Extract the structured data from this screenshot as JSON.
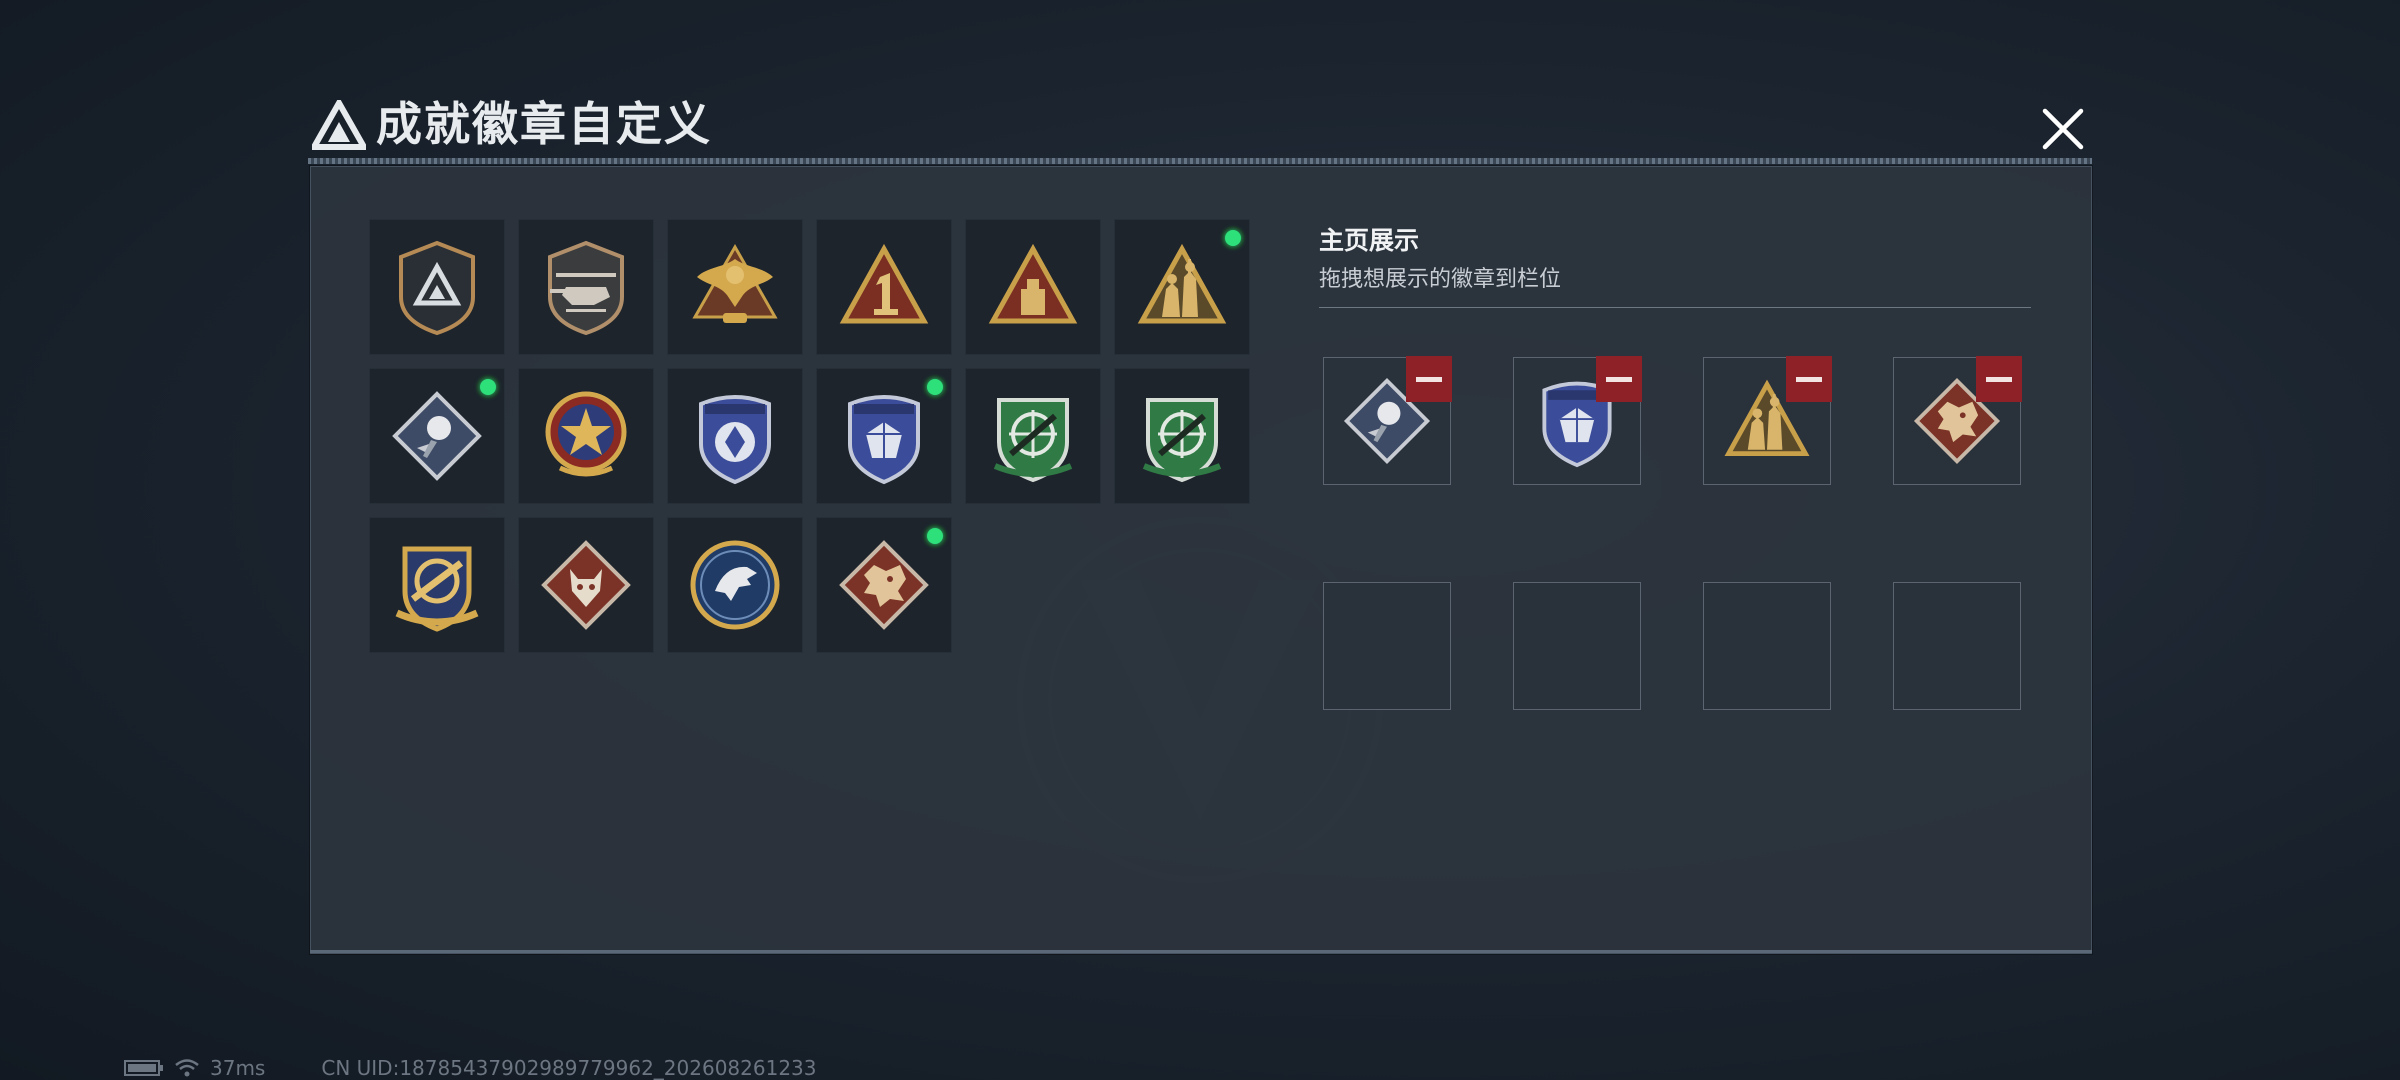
{
  "dialog": {
    "title": "成就徽章自定义",
    "close_label": "close"
  },
  "badges": [
    {
      "name": "shield-triangle-badge",
      "selected": false
    },
    {
      "name": "helicopter-badge",
      "selected": false
    },
    {
      "name": "golden-eagle-badge",
      "selected": false
    },
    {
      "name": "rank-one-badge",
      "selected": false
    },
    {
      "name": "crate-triangle-badge",
      "selected": false
    },
    {
      "name": "soldiers-triangle-badge",
      "selected": true
    },
    {
      "name": "rose-diamond-badge",
      "selected": true
    },
    {
      "name": "star-medal-badge",
      "selected": false
    },
    {
      "name": "blue-shield-emblem-badge",
      "selected": false
    },
    {
      "name": "blue-shield-gem-badge",
      "selected": true
    },
    {
      "name": "green-sniper-badge-1",
      "selected": false
    },
    {
      "name": "green-sniper-badge-2",
      "selected": false
    },
    {
      "name": "gold-crosshair-shield-badge",
      "selected": false
    },
    {
      "name": "wolf-diamond-badge",
      "selected": false
    },
    {
      "name": "eagle-circle-badge",
      "selected": false
    },
    {
      "name": "dragon-diamond-badge",
      "selected": true
    }
  ],
  "showcase": {
    "title": "主页展示",
    "hint": "拖拽想展示的徽章到栏位",
    "slots": [
      {
        "badge": "rose-diamond-badge"
      },
      {
        "badge": "blue-shield-gem-badge"
      },
      {
        "badge": "soldiers-triangle-badge"
      },
      {
        "badge": "dragon-diamond-badge"
      },
      {
        "badge": ""
      },
      {
        "badge": ""
      },
      {
        "badge": ""
      },
      {
        "badge": ""
      }
    ]
  },
  "status": {
    "ping": "37ms",
    "uid": "CN UID:18785437902989779962_202608261233"
  },
  "colors": {
    "selected_dot": "#2ee07a",
    "remove_button": "#8e2027",
    "gold": "#c9a04a",
    "blue": "#3b4c9a",
    "green": "#2f7a45",
    "rust": "#7a3326"
  }
}
